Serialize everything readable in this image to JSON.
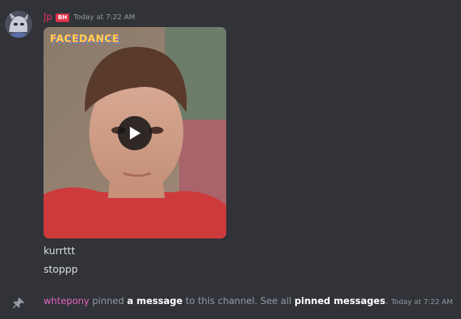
{
  "message": {
    "author": "Jp",
    "author_tag": "BH",
    "timestamp": "Today at 7:22 AM",
    "video": {
      "watermark": "FACEDANCE",
      "play_icon": "play-icon"
    },
    "lines": [
      "kurrttt",
      "stoppp"
    ]
  },
  "system_message": {
    "icon": "pin-icon",
    "actor": "whtepony",
    "text_pinned": " pinned ",
    "link_message": "a message",
    "text_channel": " to this channel. See all ",
    "link_pinned": "pinned messages",
    "text_period": ".",
    "timestamp": "Today at 7:22 AM"
  },
  "colors": {
    "background": "#313338",
    "username": "#e8315a",
    "actor": "#e664c0",
    "muted_text": "#949ba4",
    "message_text": "#dbdee1"
  }
}
